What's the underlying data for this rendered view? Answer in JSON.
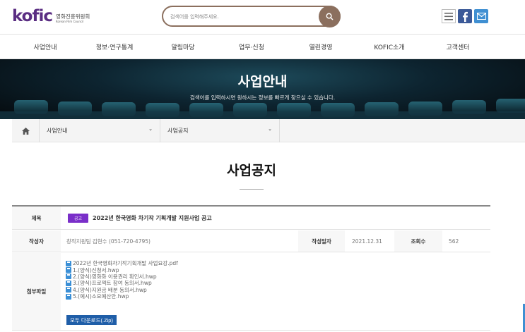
{
  "header": {
    "logo_word": "kofic",
    "logo_korean": "영화진흥위원회",
    "logo_english": "Korean Film Council",
    "search_placeholder": "검색어를 입력해주세요.",
    "icons": [
      "menu-icon",
      "facebook-icon",
      "mail-icon"
    ]
  },
  "nav": {
    "items": [
      {
        "label": "사업안내"
      },
      {
        "label": "정보·연구통계"
      },
      {
        "label": "알림마당"
      },
      {
        "label": "업무·신청"
      },
      {
        "label": "열린경영"
      },
      {
        "label": "KOFIC소개"
      },
      {
        "label": "고객센터"
      }
    ]
  },
  "banner": {
    "title": "사업안내",
    "description": "검색어를 입력하시면 원하시는 정보를 빠르게 찾으실 수 있습니다."
  },
  "breadcrumb": {
    "level1": "사업안내",
    "level2": "사업공지"
  },
  "page": {
    "title": "사업공지"
  },
  "post": {
    "subject_label": "제목",
    "badge": "공고",
    "subject": "2022년 한국영화 차기작 기획개발 지원사업 공고",
    "author_label": "작성자",
    "author": "창작지원팀 김현수 (051-720-4795)",
    "date_label": "작성일자",
    "date": "2021.12.31",
    "views_label": "조회수",
    "views": "562",
    "attach_label": "첨부파일",
    "attachments": [
      "2022년 한국영화차기작기획개발 사업요강.pdf",
      "1.(양식)신청서.hwp",
      "2.(양식)영화화 이용권리 확인서.hwp",
      "3.(양식)프로젝트 참여 동의서.hwp",
      "4.(양식)지원금 배분 동의서.hwp",
      "5.(예시)소요예산안.hwp"
    ],
    "download_all": "모두 다운로드(.Zip)"
  },
  "colors": {
    "brand_purple": "#5a2d82",
    "search_brown": "#8b6f5e",
    "badge_purple": "#7a2fc9",
    "download_blue": "#1f5ea8"
  }
}
